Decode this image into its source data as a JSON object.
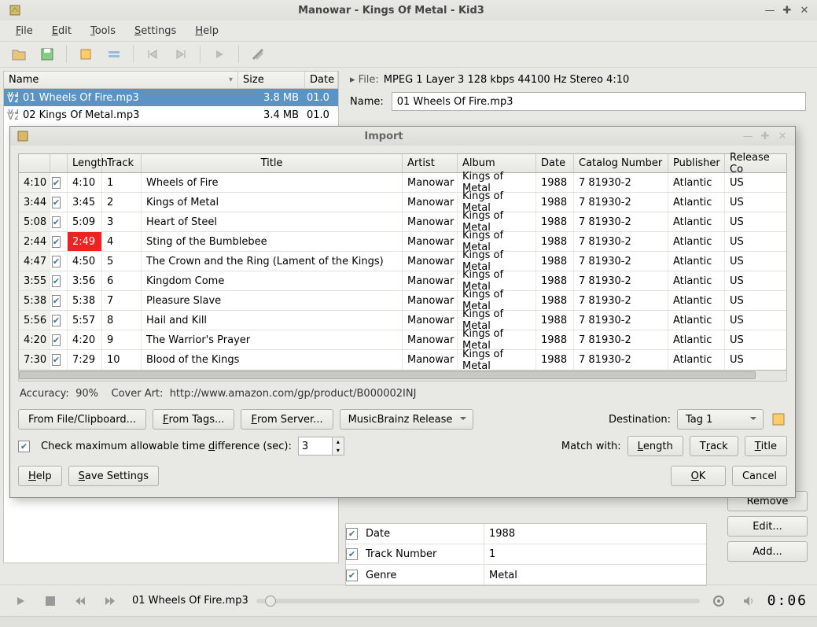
{
  "window": {
    "title": "Manowar - Kings Of Metal - Kid3"
  },
  "menu": {
    "file": "File",
    "edit": "Edit",
    "tools": "Tools",
    "settings": "Settings",
    "help": "Help"
  },
  "file_table": {
    "headers": {
      "name": "Name",
      "size": "Size",
      "date": "Date"
    },
    "rows": [
      {
        "name": "01 Wheels Of Fire.mp3",
        "size": "3.8 MB",
        "date": "01.0",
        "selected": true
      },
      {
        "name": "02 Kings Of Metal.mp3",
        "size": "3.4 MB",
        "date": "01.0",
        "selected": false
      }
    ]
  },
  "file_info": {
    "prefix": "▸  File:",
    "text": "MPEG 1 Layer 3 128 kbps 44100 Hz Stereo 4:10",
    "name_label": "Name:",
    "name_value": "01 Wheels Of Fire.mp3"
  },
  "tag_rows": [
    {
      "field": "Date",
      "value": "1988"
    },
    {
      "field": "Track Number",
      "value": "1"
    },
    {
      "field": "Genre",
      "value": "Metal"
    }
  ],
  "side_buttons": {
    "remove": "Remove",
    "edit": "Edit...",
    "add": "Add..."
  },
  "player": {
    "track": "01 Wheels Of Fire.mp3",
    "time": "0:06"
  },
  "import": {
    "title": "Import",
    "headers": {
      "length": "Length",
      "track": "Track",
      "title": "Title",
      "artist": "Artist",
      "album": "Album",
      "date": "Date",
      "catalog": "Catalog Number",
      "publisher": "Publisher",
      "release": "Release Co"
    },
    "rows": [
      {
        "dur": "4:10",
        "len": "4:10",
        "trk": "1",
        "title": "Wheels of Fire",
        "artist": "Manowar",
        "album": "Kings of Metal",
        "date": "1988",
        "cat": "7 81930-2",
        "pub": "Atlantic",
        "rc": "US",
        "warn": false
      },
      {
        "dur": "3:44",
        "len": "3:45",
        "trk": "2",
        "title": "Kings of Metal",
        "artist": "Manowar",
        "album": "Kings of Metal",
        "date": "1988",
        "cat": "7 81930-2",
        "pub": "Atlantic",
        "rc": "US",
        "warn": false
      },
      {
        "dur": "5:08",
        "len": "5:09",
        "trk": "3",
        "title": "Heart of Steel",
        "artist": "Manowar",
        "album": "Kings of Metal",
        "date": "1988",
        "cat": "7 81930-2",
        "pub": "Atlantic",
        "rc": "US",
        "warn": false
      },
      {
        "dur": "2:44",
        "len": "2:49",
        "trk": "4",
        "title": "Sting of the Bumblebee",
        "artist": "Manowar",
        "album": "Kings of Metal",
        "date": "1988",
        "cat": "7 81930-2",
        "pub": "Atlantic",
        "rc": "US",
        "warn": true
      },
      {
        "dur": "4:47",
        "len": "4:50",
        "trk": "5",
        "title": "The Crown and the Ring (Lament of the Kings)",
        "artist": "Manowar",
        "album": "Kings of Metal",
        "date": "1988",
        "cat": "7 81930-2",
        "pub": "Atlantic",
        "rc": "US",
        "warn": false
      },
      {
        "dur": "3:55",
        "len": "3:56",
        "trk": "6",
        "title": "Kingdom Come",
        "artist": "Manowar",
        "album": "Kings of Metal",
        "date": "1988",
        "cat": "7 81930-2",
        "pub": "Atlantic",
        "rc": "US",
        "warn": false
      },
      {
        "dur": "5:38",
        "len": "5:38",
        "trk": "7",
        "title": "Pleasure Slave",
        "artist": "Manowar",
        "album": "Kings of Metal",
        "date": "1988",
        "cat": "7 81930-2",
        "pub": "Atlantic",
        "rc": "US",
        "warn": false
      },
      {
        "dur": "5:56",
        "len": "5:57",
        "trk": "8",
        "title": "Hail and Kill",
        "artist": "Manowar",
        "album": "Kings of Metal",
        "date": "1988",
        "cat": "7 81930-2",
        "pub": "Atlantic",
        "rc": "US",
        "warn": false
      },
      {
        "dur": "4:20",
        "len": "4:20",
        "trk": "9",
        "title": "The Warrior's Prayer",
        "artist": "Manowar",
        "album": "Kings of Metal",
        "date": "1988",
        "cat": "7 81930-2",
        "pub": "Atlantic",
        "rc": "US",
        "warn": false
      },
      {
        "dur": "7:30",
        "len": "7:29",
        "trk": "10",
        "title": "Blood of the Kings",
        "artist": "Manowar",
        "album": "Kings of Metal",
        "date": "1988",
        "cat": "7 81930-2",
        "pub": "Atlantic",
        "rc": "US",
        "warn": false
      }
    ],
    "accuracy_label": "Accuracy:",
    "accuracy_value": "90%",
    "coverart_label": "Cover Art:",
    "coverart_value": "http://www.amazon.com/gp/product/B000002INJ",
    "buttons": {
      "from_file": "From File/Clipboard...",
      "from_tags": "From Tags...",
      "from_server": "From Server...",
      "source": "MusicBrainz Release",
      "destination_label": "Destination:",
      "destination_value": "Tag 1",
      "check_time": "Check maximum allowable time difference (sec):",
      "time_value": "3",
      "match_label": "Match with:",
      "match_length": "Length",
      "match_track": "Track",
      "match_title": "Title",
      "help": "Help",
      "save": "Save Settings",
      "ok": "OK",
      "cancel": "Cancel"
    }
  }
}
